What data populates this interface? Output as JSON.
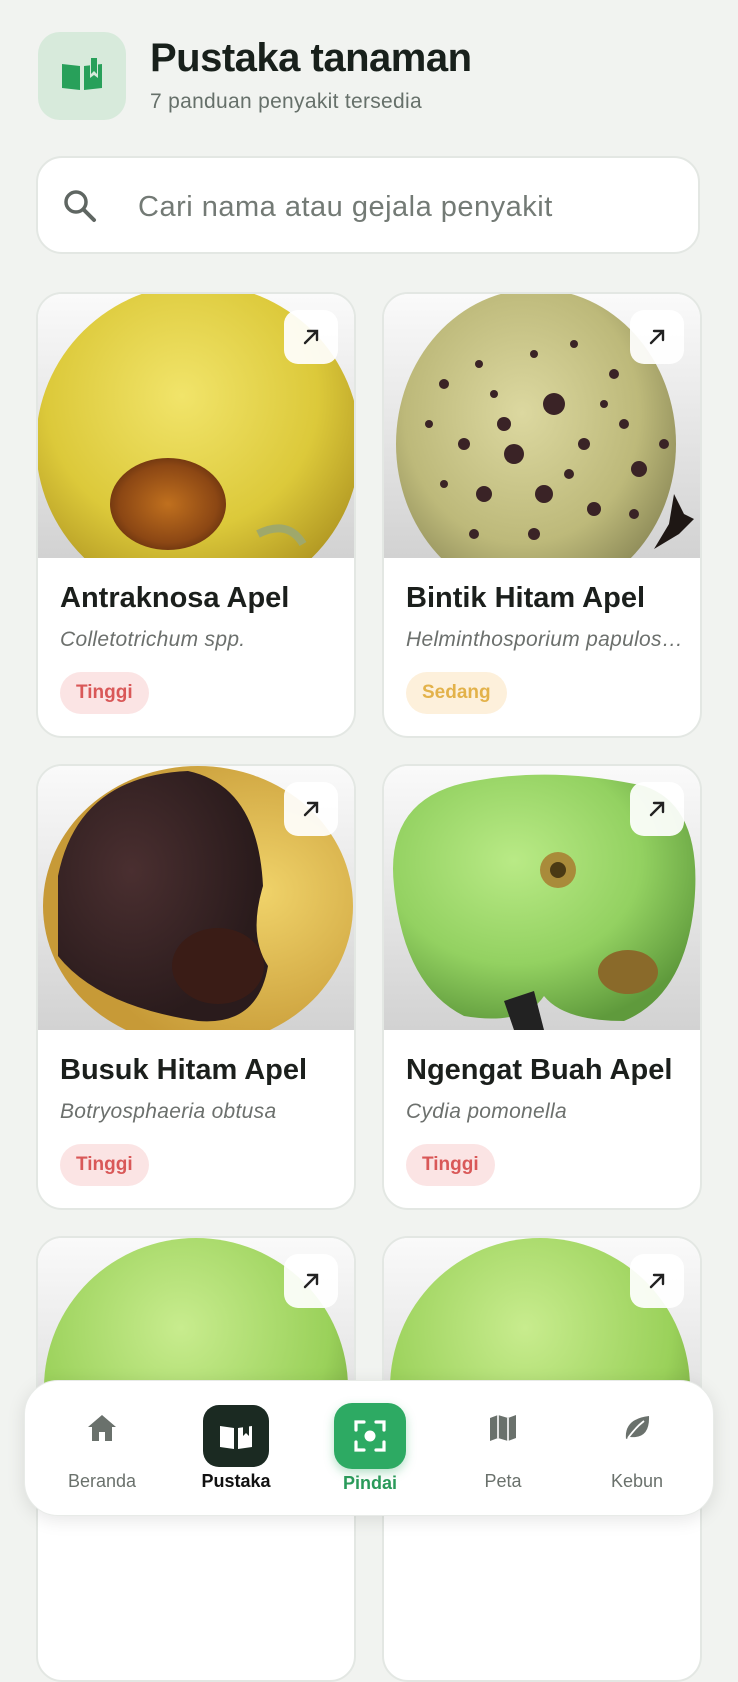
{
  "header": {
    "title": "Pustaka tanaman",
    "subtitle": "7 panduan penyakit tersedia",
    "logo_icon": "open-book-icon"
  },
  "search": {
    "placeholder": "Cari nama atau gejala penyakit",
    "icon": "search-icon"
  },
  "cards": [
    {
      "name": "Antraknosa Apel",
      "scientific": "Colletotrichum spp.",
      "severity": "Tinggi",
      "severity_level": "high"
    },
    {
      "name": "Bintik Hitam Apel",
      "scientific": "Helminthosporium papulosum",
      "severity": "Sedang",
      "severity_level": "medium"
    },
    {
      "name": "Busuk Hitam Apel",
      "scientific": "Botryosphaeria obtusa",
      "severity": "Tinggi",
      "severity_level": "high"
    },
    {
      "name": "Ngengat Buah Apel",
      "scientific": "Cydia pomonella",
      "severity": "Tinggi",
      "severity_level": "high"
    },
    {
      "name": "",
      "scientific": "",
      "severity": ""
    },
    {
      "name": "",
      "scientific": "",
      "severity": ""
    }
  ],
  "nav": {
    "items": [
      {
        "label": "Beranda",
        "icon": "home-icon"
      },
      {
        "label": "Pustaka",
        "icon": "book-icon",
        "active": true
      },
      {
        "label": "Pindai",
        "icon": "scan-icon"
      },
      {
        "label": "Peta",
        "icon": "map-icon"
      },
      {
        "label": "Kebun",
        "icon": "leaf-icon"
      }
    ]
  },
  "colors": {
    "accent": "#2daa63",
    "active_nav": "#1b2a22",
    "severity_high": "#d95858",
    "severity_medium": "#e3b24a"
  }
}
